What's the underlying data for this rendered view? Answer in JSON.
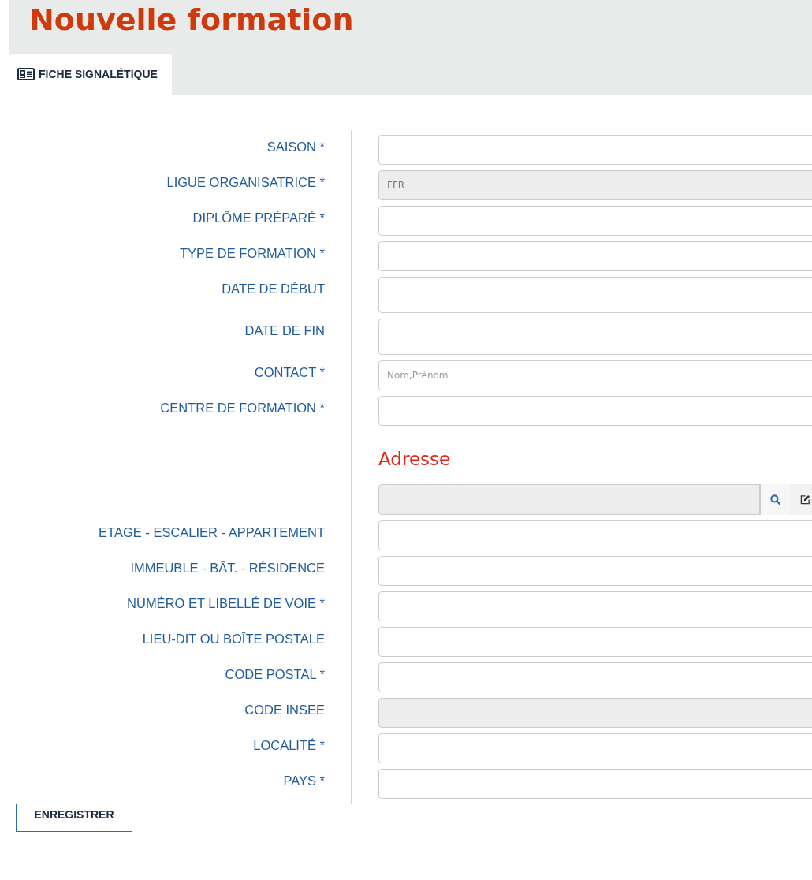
{
  "title": "Nouvelle formation",
  "tabs": [
    {
      "label": "FICHE SIGNALÉTIQUE",
      "selected": true
    }
  ],
  "fields": [
    {
      "kind": "text",
      "label": "SAISON *"
    },
    {
      "kind": "disabled",
      "label": "LIGUE ORGANISATRICE *",
      "value": "FFR"
    },
    {
      "kind": "text",
      "label": "DIPLÔME PRÉPARÉ *"
    },
    {
      "kind": "text",
      "label": "TYPE DE FORMATION *"
    },
    {
      "kind": "date",
      "label": "DATE DE DÉBUT"
    },
    {
      "kind": "date",
      "label": "DATE DE FIN"
    },
    {
      "kind": "text",
      "label": "CONTACT *",
      "placeholder": "Nom,Prénom"
    },
    {
      "kind": "text",
      "label": "CENTRE DE FORMATION *"
    },
    {
      "kind": "heading",
      "label": "Adresse"
    },
    {
      "kind": "lookup"
    },
    {
      "kind": "text",
      "label": "ETAGE - ESCALIER - APPARTEMENT"
    },
    {
      "kind": "text",
      "label": "IMMEUBLE - BÂT. - RÉSIDENCE"
    },
    {
      "kind": "text",
      "label": "NUMÉRO ET LIBELLÉ DE VOIE *"
    },
    {
      "kind": "text",
      "label": "LIEU-DIT OU BOÎTE POSTALE"
    },
    {
      "kind": "text",
      "label": "CODE POSTAL *"
    },
    {
      "kind": "disabled",
      "label": "CODE INSEE"
    },
    {
      "kind": "text",
      "label": "LOCALITÉ *"
    },
    {
      "kind": "text",
      "label": "PAYS *"
    }
  ],
  "save_button": "ENREGISTRER"
}
